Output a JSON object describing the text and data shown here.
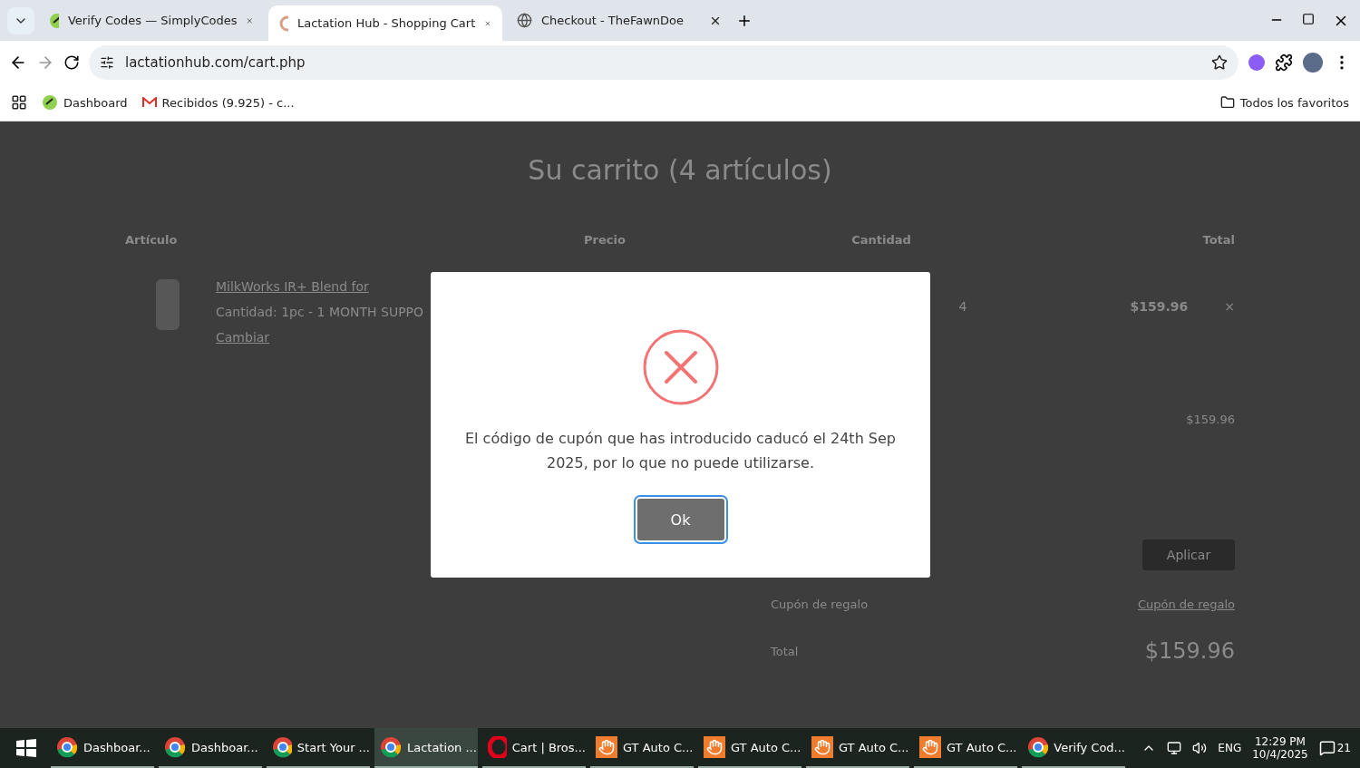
{
  "tabs": [
    {
      "title": "Verify Codes — SimplyCodes",
      "selected": false
    },
    {
      "title": "Lactation Hub - Shopping Cart",
      "selected": true
    },
    {
      "title": "Checkout - TheFawnDoe",
      "selected": false
    }
  ],
  "address": "lactationhub.com/cart.php",
  "bookmarks": [
    {
      "label": "Dashboard"
    },
    {
      "label": "Recibidos (9.925) - c..."
    }
  ],
  "all_bookmarks": "Todos los favoritos",
  "cart": {
    "title": "Su carrito (4 artículos)",
    "columns": [
      "Artículo",
      "Precio",
      "Cantidad",
      "Total"
    ],
    "item": {
      "name": "MilkWorks IR+ Blend for",
      "option": "Cantidad: 1pc - 1 MONTH SUPPO",
      "change": "Cambiar",
      "quantity": "4",
      "total": "$159.96",
      "remove": "×"
    },
    "subtotal": "$159.96",
    "coupon_button": "Aplicar",
    "gift_label": "Cupón de regalo",
    "gift_link": "Cupón de regalo",
    "total_label": "Total",
    "total": "$159.96"
  },
  "dialog": {
    "message": "El código de cupón que has introducido caducó el 24th Sep 2025, por lo que no puede utilizarse.",
    "button": "Ok"
  },
  "taskbar": [
    {
      "label": "Dashboar...",
      "kind": "chrome",
      "active": false
    },
    {
      "label": "Dashboar...",
      "kind": "chrome",
      "active": false
    },
    {
      "label": "Start Your ...",
      "kind": "chrome",
      "active": false
    },
    {
      "label": "Lactation ...",
      "kind": "chrome",
      "active": true
    },
    {
      "label": "Cart | Bros...",
      "kind": "opera",
      "active": false
    },
    {
      "label": "GT Auto C...",
      "kind": "hand",
      "active": false
    },
    {
      "label": "GT Auto C...",
      "kind": "hand",
      "active": false
    },
    {
      "label": "GT Auto C...",
      "kind": "hand",
      "active": false
    },
    {
      "label": "GT Auto C...",
      "kind": "hand",
      "active": false
    },
    {
      "label": "Verify Cod...",
      "kind": "chrome",
      "active": false
    }
  ],
  "tray": {
    "language": "ENG",
    "time": "12:29 PM",
    "date": "10/4/2025",
    "notifications": "21"
  }
}
